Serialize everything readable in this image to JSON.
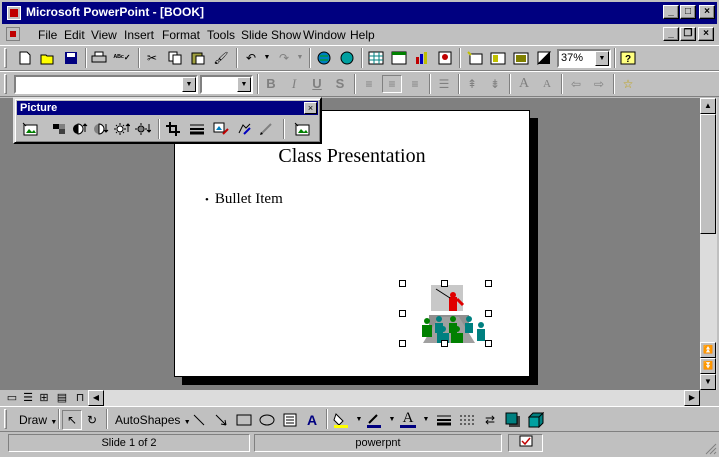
{
  "window": {
    "title": "Microsoft PowerPoint - [BOOK]"
  },
  "menu": [
    "File",
    "Edit",
    "View",
    "Insert",
    "Format",
    "Tools",
    "Slide Show",
    "Window",
    "Help"
  ],
  "toolbar": {
    "zoom": "37%"
  },
  "picture_toolbar": {
    "title": "Picture"
  },
  "slide": {
    "title": "Class Presentation",
    "bullet": "Bullet Item"
  },
  "drawing": {
    "draw_label": "Draw",
    "autoshapes_label": "AutoShapes"
  },
  "status": {
    "slide": "Slide 1 of 2",
    "template": "powerpnt"
  },
  "icons": [
    "app-icon",
    "new-icon",
    "open-icon",
    "save-icon",
    "print-icon",
    "spell-icon",
    "cut-icon",
    "copy-icon",
    "paste-icon",
    "format-painter-icon",
    "undo-icon",
    "redo-icon",
    "hyperlink-icon",
    "web-toolbar-icon",
    "insert-table-icon",
    "insert-chart-icon",
    "insert-clip-art-icon",
    "new-slide-icon",
    "slide-layout-icon",
    "apply-design-icon",
    "black-white-icon",
    "help-icon"
  ]
}
